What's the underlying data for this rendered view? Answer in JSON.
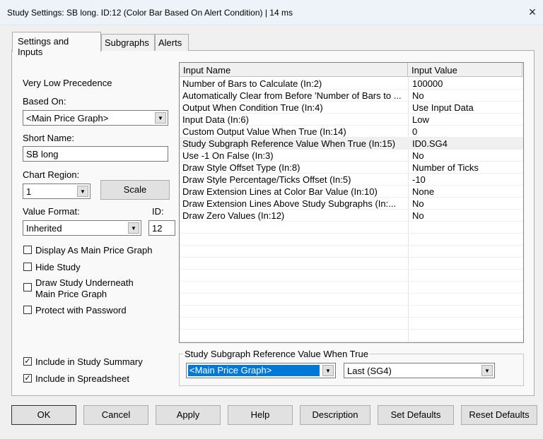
{
  "window": {
    "title": "Study Settings: SB long. ID:12 (Color Bar Based On Alert Condition) | 14 ms",
    "close_icon": "×"
  },
  "tabs": [
    {
      "label": "Settings and Inputs"
    },
    {
      "label": "Subgraphs"
    },
    {
      "label": "Alerts"
    }
  ],
  "settings": {
    "precedence": "Very Low Precedence",
    "based_on_label": "Based On:",
    "based_on_value": "<Main Price Graph>",
    "short_name_label": "Short Name:",
    "short_name_value": "SB long",
    "chart_region_label": "Chart Region:",
    "chart_region_value": "1",
    "scale_button": "Scale",
    "value_format_label": "Value Format:",
    "value_format_value": "Inherited",
    "id_label": "ID:",
    "id_value": "12",
    "checkboxes": [
      {
        "label": "Display As Main Price Graph",
        "checked": false
      },
      {
        "label": "Hide Study",
        "checked": false
      },
      {
        "label": "Draw Study Underneath",
        "label2": "Main Price Graph",
        "checked": false
      },
      {
        "label": "Protect with Password",
        "checked": false
      },
      {
        "label": "Include in Study Summary",
        "checked": true
      },
      {
        "label": "Include in Spreadsheet",
        "checked": true
      }
    ]
  },
  "inputs": {
    "headers": [
      "Input Name",
      "Input Value"
    ],
    "rows": [
      [
        "Number of Bars to Calculate   (In:2)",
        "100000"
      ],
      [
        "Automatically Clear from Before 'Number of Bars to ...",
        "No"
      ],
      [
        "Output When Condition True   (In:4)",
        "Use Input Data"
      ],
      [
        "Input Data   (In:6)",
        "Low"
      ],
      [
        "Custom Output Value When True   (In:14)",
        "0"
      ],
      [
        "Study Subgraph Reference Value When True   (In:15)",
        "ID0.SG4"
      ],
      [
        "Use -1 On False   (In:3)",
        "No"
      ],
      [
        "Draw Style Offset Type   (In:8)",
        "Number of Ticks"
      ],
      [
        "Draw Style Percentage/Ticks Offset   (In:5)",
        "-10"
      ],
      [
        "Draw Extension Lines at Color Bar Value   (In:10)",
        "None"
      ],
      [
        "Draw Extension Lines Above Study Subgraphs   (In:...",
        "No"
      ],
      [
        "Draw Zero Values   (In:12)",
        "No"
      ]
    ],
    "selected_row": 5
  },
  "reference": {
    "label": "Study Subgraph Reference Value When True",
    "study_value": "<Main Price Graph>",
    "subgraph_value": "Last (SG4)",
    "accent": "#0078d7"
  },
  "buttons": [
    "OK",
    "Cancel",
    "Apply",
    "Help",
    "Description",
    "Set Defaults",
    "Reset Defaults"
  ]
}
